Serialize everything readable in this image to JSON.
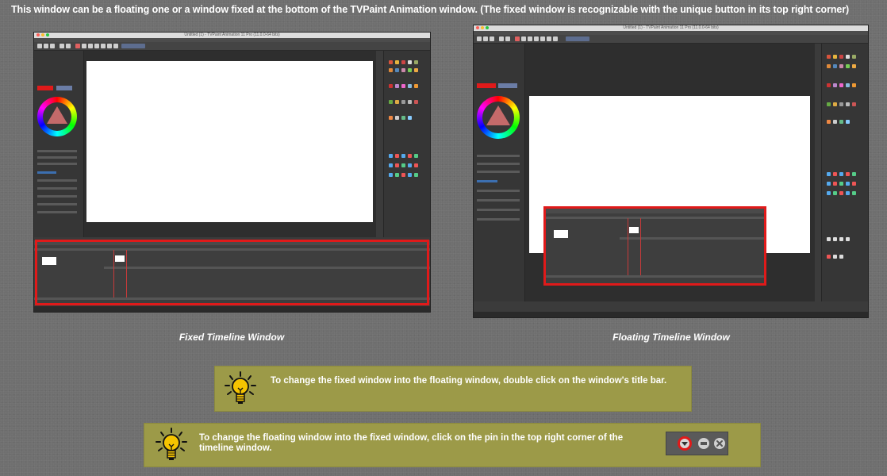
{
  "header": {
    "text": "This window can be a floating one or a window fixed at the bottom of the TVPaint Animation window. (The fixed window is recognizable with the unique button in its top right corner)"
  },
  "screenshots": [
    {
      "window_title": "Untitled (1) - TVPaint Animation 11 Pro (11.0.0-64 bits)",
      "caption": "Fixed Timeline Window",
      "mode": "fixed"
    },
    {
      "window_title": "Untitled (1) - TVPaint Animation 11 Pro (11.0.0-64 bits)",
      "caption": "Floating Timeline Window",
      "mode": "floating"
    }
  ],
  "tips": [
    {
      "icon": "lightbulb-icon",
      "text": "To change the fixed window into the floating window, double click on the window's title bar."
    },
    {
      "icon": "lightbulb-icon",
      "text": "To change the floating window into the fixed window, click on the pin in the top right corner of the timeline window."
    }
  ],
  "window_controls": {
    "buttons": [
      "pin-icon",
      "minimize-icon",
      "close-icon"
    ]
  },
  "colors": {
    "background": "#6f6f6f",
    "highlight": "#e01a1a",
    "tip_background": "#9c9a48",
    "bulb": "#f5c400"
  }
}
